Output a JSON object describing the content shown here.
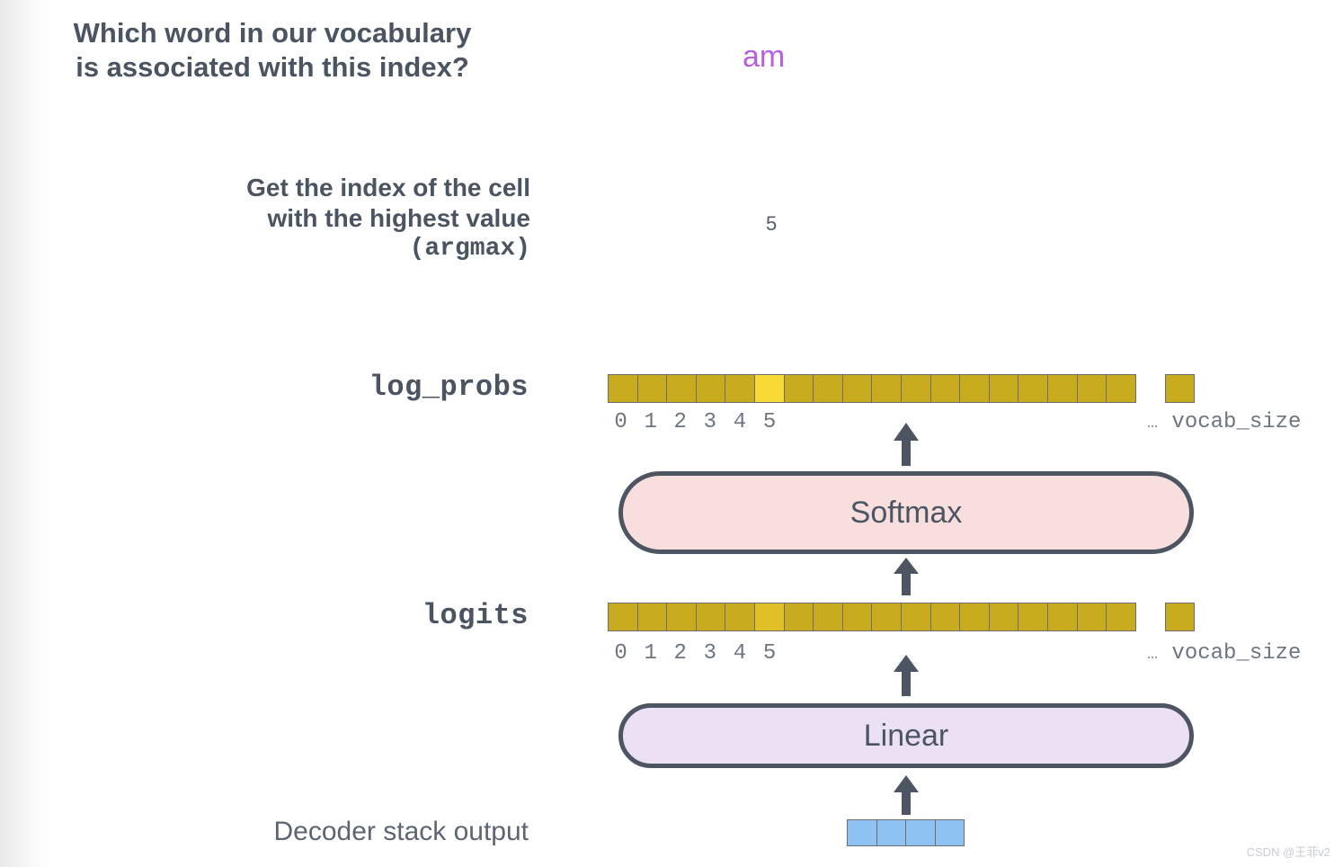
{
  "annotations": {
    "question_lines": [
      "Which word in our vocabulary",
      "is associated with this index?"
    ],
    "argmax_lines": [
      "Get the index of the cell",
      "with the highest value"
    ],
    "argmax_mono": "(argmax)",
    "answer_word": "am",
    "answer_index": "5"
  },
  "rows": {
    "log_probs": {
      "label": "log_probs",
      "tick_labels": [
        "0",
        "1",
        "2",
        "3",
        "4",
        "5"
      ],
      "ellipsis": "…",
      "end_label": "vocab_size",
      "cell_count": 18,
      "highlight_index": 5,
      "highlight_style": "strong",
      "cell_color": "#c9ab20",
      "highlight_color": "#f8da36"
    },
    "logits": {
      "label": "logits",
      "tick_labels": [
        "0",
        "1",
        "2",
        "3",
        "4",
        "5"
      ],
      "ellipsis": "…",
      "end_label": "vocab_size",
      "cell_count": 18,
      "highlight_index": 5,
      "highlight_style": "soft",
      "cell_color": "#c9ab20",
      "highlight_color": "#e0c228"
    }
  },
  "blocks": {
    "softmax": {
      "label": "Softmax",
      "fill": "#f8dedc",
      "stroke": "#4e5562"
    },
    "linear": {
      "label": "Linear",
      "fill": "#ece0f4",
      "stroke": "#4e5562"
    }
  },
  "decoder": {
    "label": "Decoder stack output",
    "cell_count": 4,
    "cell_color": "#8ec2f2"
  },
  "colors": {
    "text": "#4b5461",
    "muted_text": "#6d7581",
    "answer_word": "#b95ee0",
    "arrow": "#4e5562"
  },
  "watermark": "CSDN @王菲v2"
}
